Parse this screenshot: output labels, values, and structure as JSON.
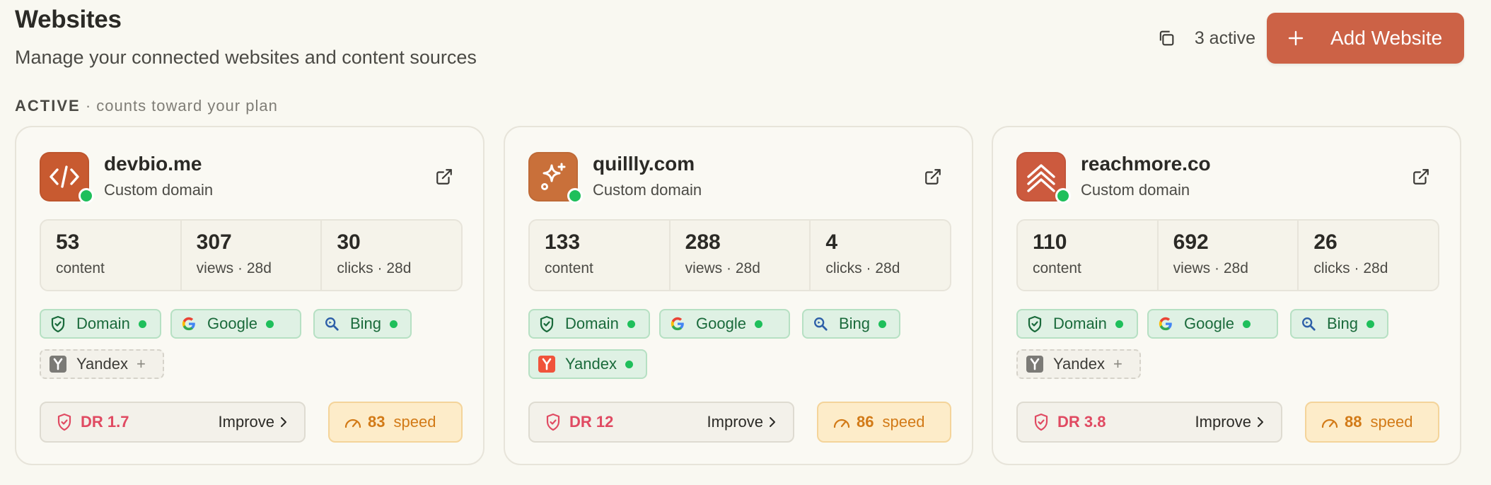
{
  "page": {
    "title": "Websites",
    "subtitle": "Manage your connected websites and content sources"
  },
  "header": {
    "copy_icon": "copy-icon",
    "active_count": "3 active",
    "add_button_label": "Add Website",
    "accent_color": "#cc6246"
  },
  "section": {
    "label": "ACTIVE",
    "note": "· counts toward your plan"
  },
  "sites": [
    {
      "name": "devbio.me",
      "type": "Custom domain",
      "logo_icon": "code-icon",
      "logo_color": "#c85a30",
      "stats": [
        {
          "value": "53",
          "label": "content"
        },
        {
          "value": "307",
          "label": "views · 28d"
        },
        {
          "value": "30",
          "label": "clicks · 28d"
        }
      ],
      "integrations": [
        {
          "label": "Domain",
          "status": "connected"
        },
        {
          "label": "Google",
          "status": "connected"
        },
        {
          "label": "Bing",
          "status": "connected"
        },
        {
          "label": "Yandex",
          "status": "not-connected"
        }
      ],
      "dr": "DR 1.7",
      "improve_label": "Improve",
      "speed_value": "83",
      "speed_label": "speed"
    },
    {
      "name": "quillly.com",
      "type": "Custom domain",
      "logo_icon": "sparkle-icon",
      "logo_color": "#c9703a",
      "stats": [
        {
          "value": "133",
          "label": "content"
        },
        {
          "value": "288",
          "label": "views · 28d"
        },
        {
          "value": "4",
          "label": "clicks · 28d"
        }
      ],
      "integrations": [
        {
          "label": "Domain",
          "status": "connected"
        },
        {
          "label": "Google",
          "status": "connected"
        },
        {
          "label": "Bing",
          "status": "connected"
        },
        {
          "label": "Yandex",
          "status": "connected"
        }
      ],
      "dr": "DR 12",
      "improve_label": "Improve",
      "speed_value": "86",
      "speed_label": "speed"
    },
    {
      "name": "reachmore.co",
      "type": "Custom domain",
      "logo_icon": "chevrons-up-icon",
      "logo_color": "#cc5a3e",
      "stats": [
        {
          "value": "110",
          "label": "content"
        },
        {
          "value": "692",
          "label": "views · 28d"
        },
        {
          "value": "26",
          "label": "clicks · 28d"
        }
      ],
      "integrations": [
        {
          "label": "Domain",
          "status": "connected"
        },
        {
          "label": "Google",
          "status": "connected"
        },
        {
          "label": "Bing",
          "status": "connected"
        },
        {
          "label": "Yandex",
          "status": "not-connected"
        }
      ],
      "dr": "DR 3.8",
      "improve_label": "Improve",
      "speed_value": "88",
      "speed_label": "speed"
    }
  ]
}
